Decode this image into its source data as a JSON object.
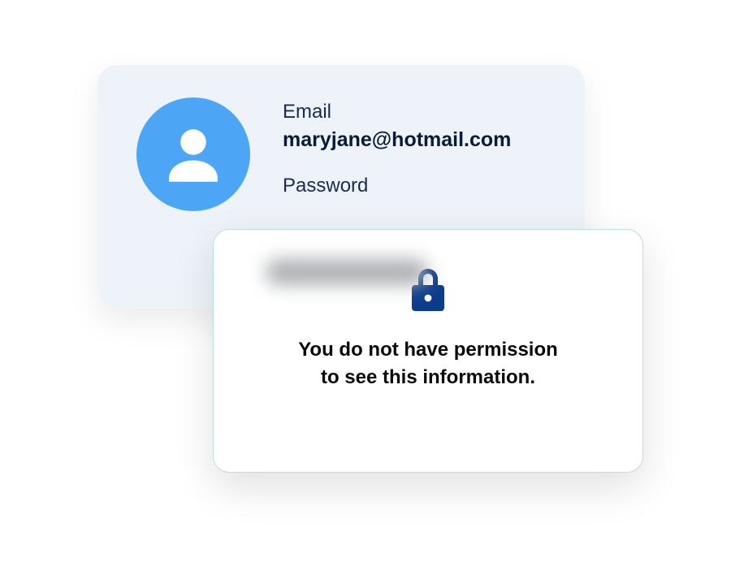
{
  "profile": {
    "email_label": "Email",
    "email_value": "maryjane@hotmail.com",
    "password_label": "Password"
  },
  "permission": {
    "message_line1": "You do not have permission",
    "message_line2": "to see this information."
  },
  "colors": {
    "avatar_bg": "#4da5f5",
    "card_bg": "#edf3f8",
    "text_dark": "#0a1a3a",
    "lock_color": "#0c3c8c"
  }
}
